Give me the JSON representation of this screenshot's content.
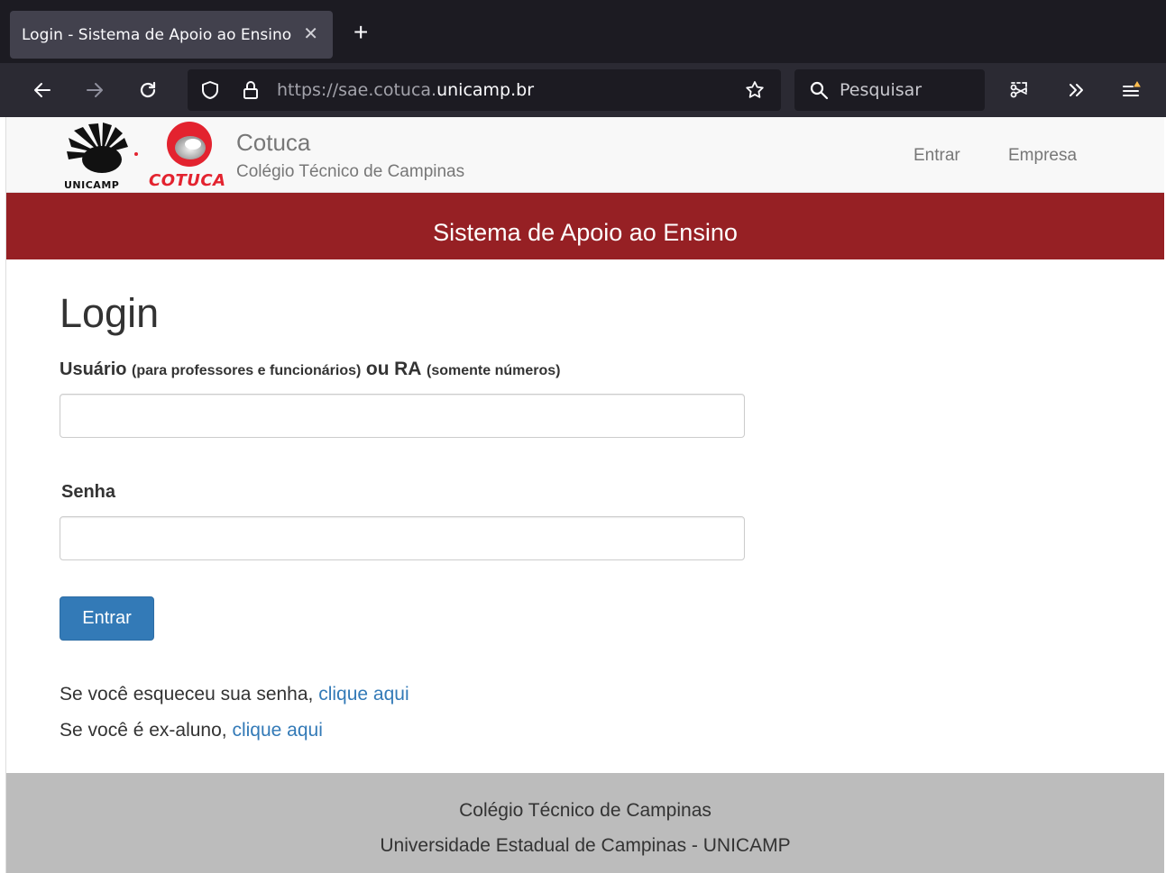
{
  "browser": {
    "tab_title": "Login - Sistema de Apoio ao Ensino",
    "tab_close": "✕",
    "new_tab": "+",
    "url_prefix": "https://sae.cotuca.",
    "url_domain": "unicamp.br",
    "search_placeholder": "Pesquisar",
    "theme_colors": {
      "tabbar": "#1c1b22",
      "toolbar": "#2b2a33",
      "active_tab": "#42414d"
    }
  },
  "site": {
    "unicamp_logo_text": "UNICAMP",
    "cotuca_logo_text": "COTUCA",
    "brand_title": "Cotuca",
    "brand_subtitle": "Colégio Técnico de Campinas",
    "nav": [
      {
        "label": "Entrar"
      },
      {
        "label": "Empresa"
      }
    ],
    "banner": "Sistema de Apoio ao Ensino",
    "colors": {
      "banner": "#962024",
      "button": "#337ab7",
      "link": "#337ab7",
      "footer": "#bcbcbc"
    }
  },
  "login": {
    "title": "Login",
    "user_label": "Usuário",
    "user_note1": "(para professores e funcionários)",
    "user_or": "ou",
    "user_ra": "RA",
    "user_note2": "(somente números)",
    "user_value": "",
    "password_label": "Senha",
    "password_value": "",
    "submit_label": "Entrar"
  },
  "help": {
    "forgot_prefix": "Se você esqueceu sua senha,",
    "forgot_link": "clique aqui",
    "alumni_prefix": "Se você é ex-aluno,",
    "alumni_link": "clique aqui"
  },
  "footer": {
    "line1": "Colégio Técnico de Campinas",
    "line2": "Universidade Estadual de Campinas - UNICAMP"
  }
}
